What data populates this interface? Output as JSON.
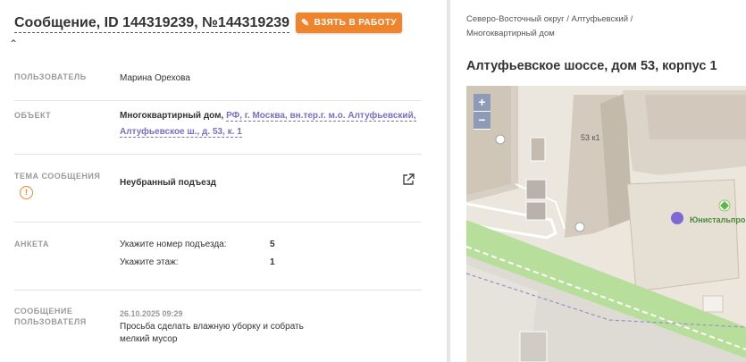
{
  "header": {
    "title": "Сообщение, ID 144319239, №144319239",
    "take_button": "ВЗЯТЬ В РАБОТУ"
  },
  "fields": {
    "user": {
      "label": "ПОЛЬЗОВАТЕЛЬ",
      "value": "Марина Орехова"
    },
    "object": {
      "label": "ОБЪЕКТ",
      "type": "Многоквартирный дом,",
      "address_line1": "РФ, г. Москва, вн.тер.г. м.о. Алтуфьевский,",
      "address_line2": "Алтуфьевское ш., д. 53, к. 1"
    },
    "topic": {
      "label": "ТЕМА СООБЩЕНИЯ",
      "value": "Неубранный подъезд"
    },
    "survey": {
      "label": "АНКЕТА",
      "items": [
        {
          "q": "Укажите номер подъезда:",
          "a": "5"
        },
        {
          "q": "Укажите этаж:",
          "a": "1"
        }
      ]
    },
    "message": {
      "label_line1": "СООБЩЕНИЕ",
      "label_line2": "ПОЛЬЗОВАТЕЛЯ",
      "date": "26.10.2025 09:29",
      "text": "Просьба сделать влажную уборку и собрать мелкий мусор"
    }
  },
  "right": {
    "breadcrumb": [
      "Северо-Восточный округ /",
      "Алтуфьевский /",
      "Многоквартирный дом"
    ],
    "address": "Алтуфьевское шоссе, дом 53, корпус 1",
    "map": {
      "zoom_in": "+",
      "zoom_out": "−",
      "building_label": "53 к1",
      "poi_label": "Юнистальпро"
    }
  },
  "colors": {
    "accent": "#f0842c",
    "link": "#7a6ec6",
    "marker": "#7d68d6",
    "zoom": "#8e9bb8",
    "grass": "#b8de9c",
    "road": "#f4f2ee"
  }
}
